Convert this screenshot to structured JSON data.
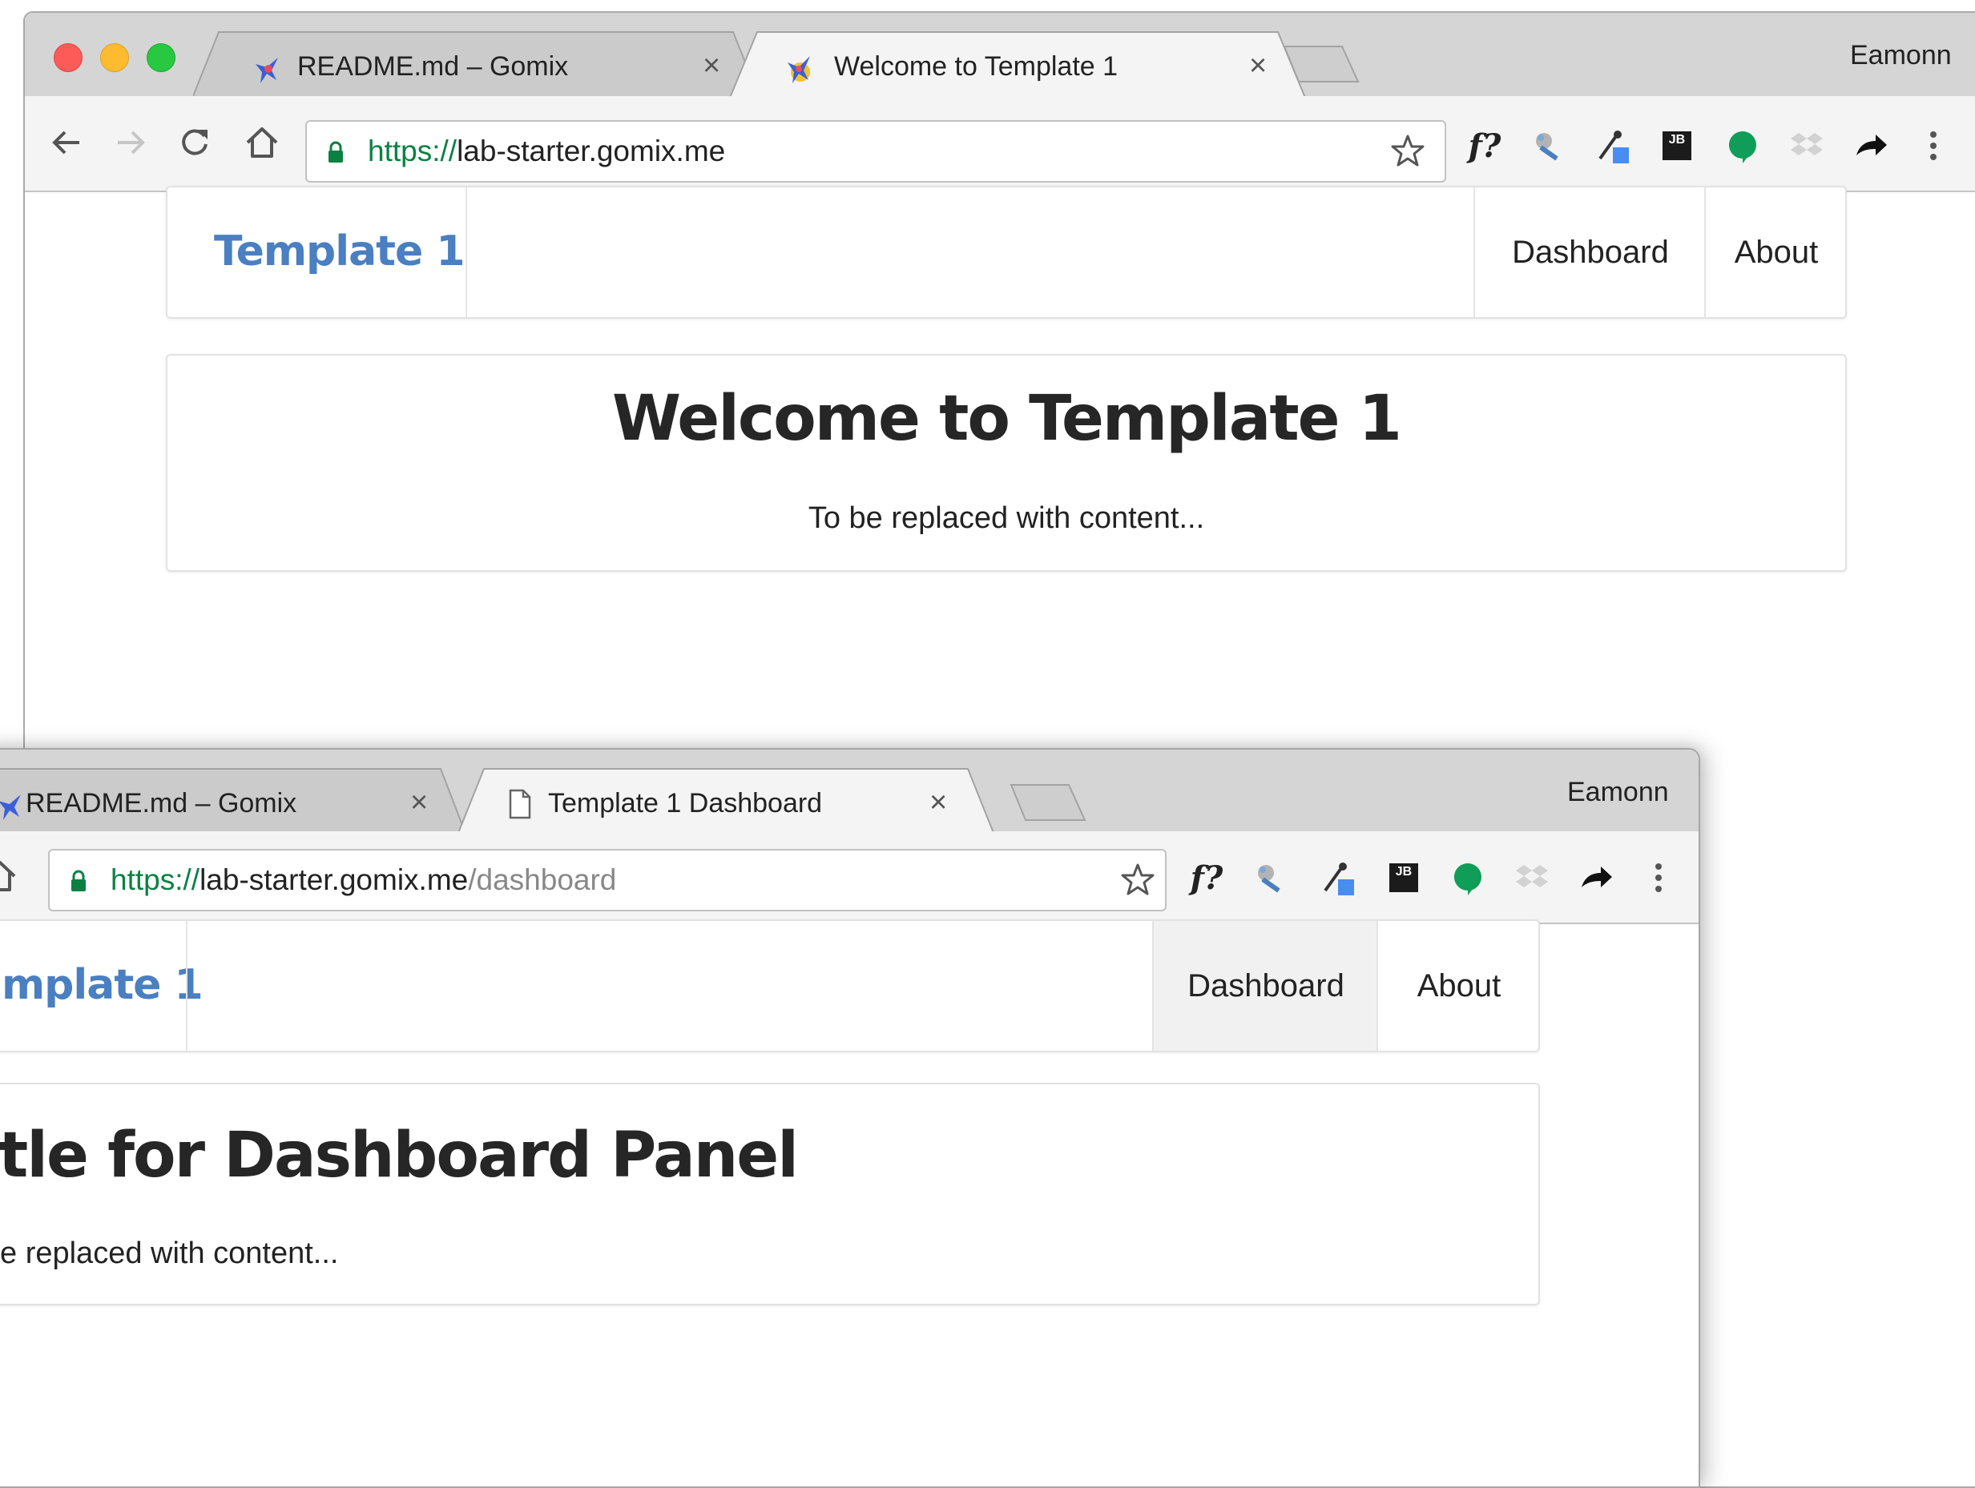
{
  "back_window": {
    "tabs": [
      {
        "title": "README.md – Gomix",
        "favicon": "gomix-bird-icon"
      },
      {
        "title": "Welcome to Template 1",
        "favicon": "gomix-bird-icon",
        "active": true
      }
    ],
    "profile": "Eamonn",
    "url": {
      "scheme": "https://",
      "host": "lab-starter.gomix.me",
      "path": ""
    },
    "extensions": [
      "fx-icon",
      "satellite-icon",
      "eyedropper-icon",
      "jetbrains-icon",
      "green-bubble-icon",
      "dropbox-icon",
      "share-arrow-icon",
      "menu-dots-icon"
    ],
    "fx_label": "f?",
    "jb_label": "JB",
    "page": {
      "brand": "Template 1",
      "nav": [
        "Dashboard",
        "About"
      ],
      "heading": "Welcome to Template 1",
      "body": "To be replaced with content..."
    }
  },
  "front_window": {
    "tabs": [
      {
        "title": "README.md – Gomix",
        "favicon": "gomix-bird-icon"
      },
      {
        "title": "Template 1 Dashboard",
        "favicon": "document-icon",
        "active": true
      }
    ],
    "profile": "Eamonn",
    "url": {
      "scheme": "https://",
      "host": "lab-starter.gomix.me",
      "path": "/dashboard"
    },
    "fx_label": "f?",
    "jb_label": "JB",
    "page": {
      "brand": "mplate 1",
      "nav": [
        "Dashboard",
        "About"
      ],
      "active_nav": "Dashboard",
      "heading": "tle for Dashboard Panel",
      "body": "e replaced with content..."
    }
  },
  "colors": {
    "brand": "#4a7fc1",
    "secure_green": "#0b8043",
    "chrome_bar": "#d5d5d5",
    "toolbar": "#f4f4f4"
  }
}
